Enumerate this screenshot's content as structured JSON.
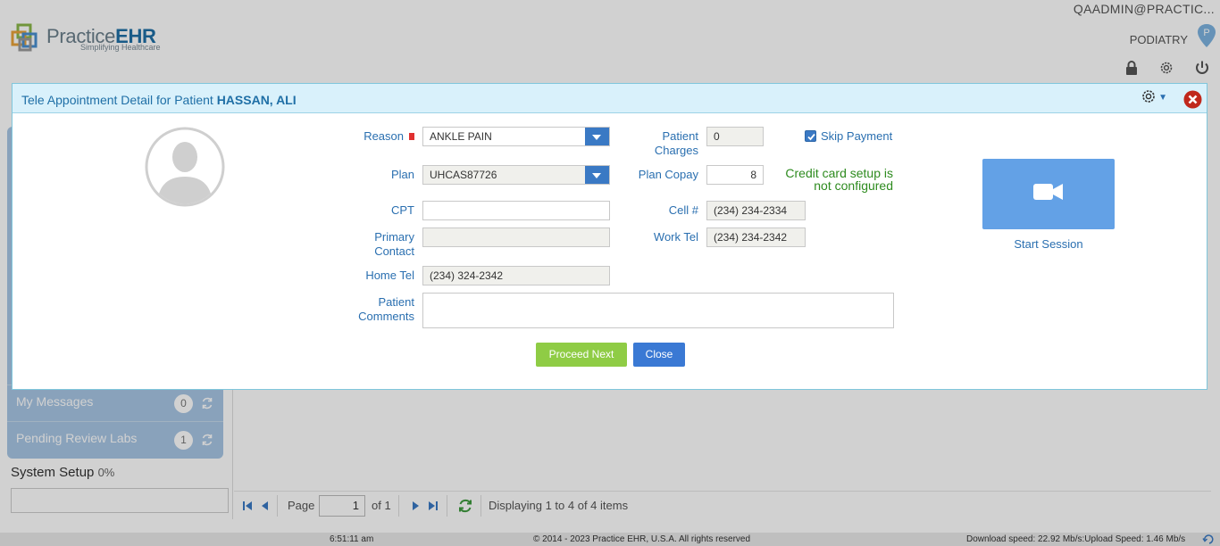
{
  "header": {
    "logo_practice": "Practice",
    "logo_ehr": "EHR",
    "logo_tagline": "Simplifying Healthcare",
    "user": "QAADMIN@PRACTIC...",
    "practice": "PODIATRY",
    "pin_letter": "P"
  },
  "sidebar": {
    "items": [
      {
        "label": "My Messages",
        "count": "0"
      },
      {
        "label": "Pending Review Labs",
        "count": "1"
      }
    ],
    "system_setup": {
      "label": "System Setup",
      "percent": "0%"
    }
  },
  "pager": {
    "page_label": "Page",
    "page_value": "1",
    "of_label": "of 1",
    "display_text": "Displaying 1 to 4 of 4 items"
  },
  "status": {
    "time": "6:51:11 am",
    "copyright": "© 2014 - 2023 Practice EHR, U.S.A. All rights reserved",
    "speed": "Download speed: 22.92 Mb/s:Upload Speed: 1.46 Mb/s"
  },
  "dialog": {
    "title_prefix": "Tele Appointment Detail for Patient ",
    "patient_name": "HASSAN, ALI",
    "fields": {
      "reason": {
        "label": "Reason",
        "value": "ANKLE PAIN"
      },
      "plan": {
        "label": "Plan",
        "value": "UHCAS87726"
      },
      "cpt": {
        "label": "CPT",
        "value": ""
      },
      "primary_contact": {
        "label_line1": "Primary",
        "label_line2": "Contact",
        "value": ""
      },
      "home_tel": {
        "label": "Home Tel",
        "value": "(234) 324-2342"
      },
      "patient_comments": {
        "label_line1": "Patient",
        "label_line2": "Comments",
        "value": ""
      },
      "patient_charges": {
        "label_line1": "Patient",
        "label_line2": "Charges",
        "value": "0"
      },
      "plan_copay": {
        "label": "Plan Copay",
        "value": "8"
      },
      "cell": {
        "label": "Cell #",
        "value": "(234) 234-2334"
      },
      "work_tel": {
        "label": "Work Tel",
        "value": "(234) 234-2342"
      }
    },
    "skip_payment": {
      "label": "Skip Payment",
      "checked": true
    },
    "credit_message_line1": "Credit card setup is",
    "credit_message_line2": "not configured",
    "start_session_label": "Start Session",
    "proceed_label": "Proceed Next",
    "close_label": "Close"
  },
  "colors": {
    "accent_blue": "#3a79c4",
    "proceed_green": "#8fcc45",
    "message_green": "#2e8b1f",
    "dialog_header": "#d9f1fb",
    "video_button": "#63a1e6"
  }
}
